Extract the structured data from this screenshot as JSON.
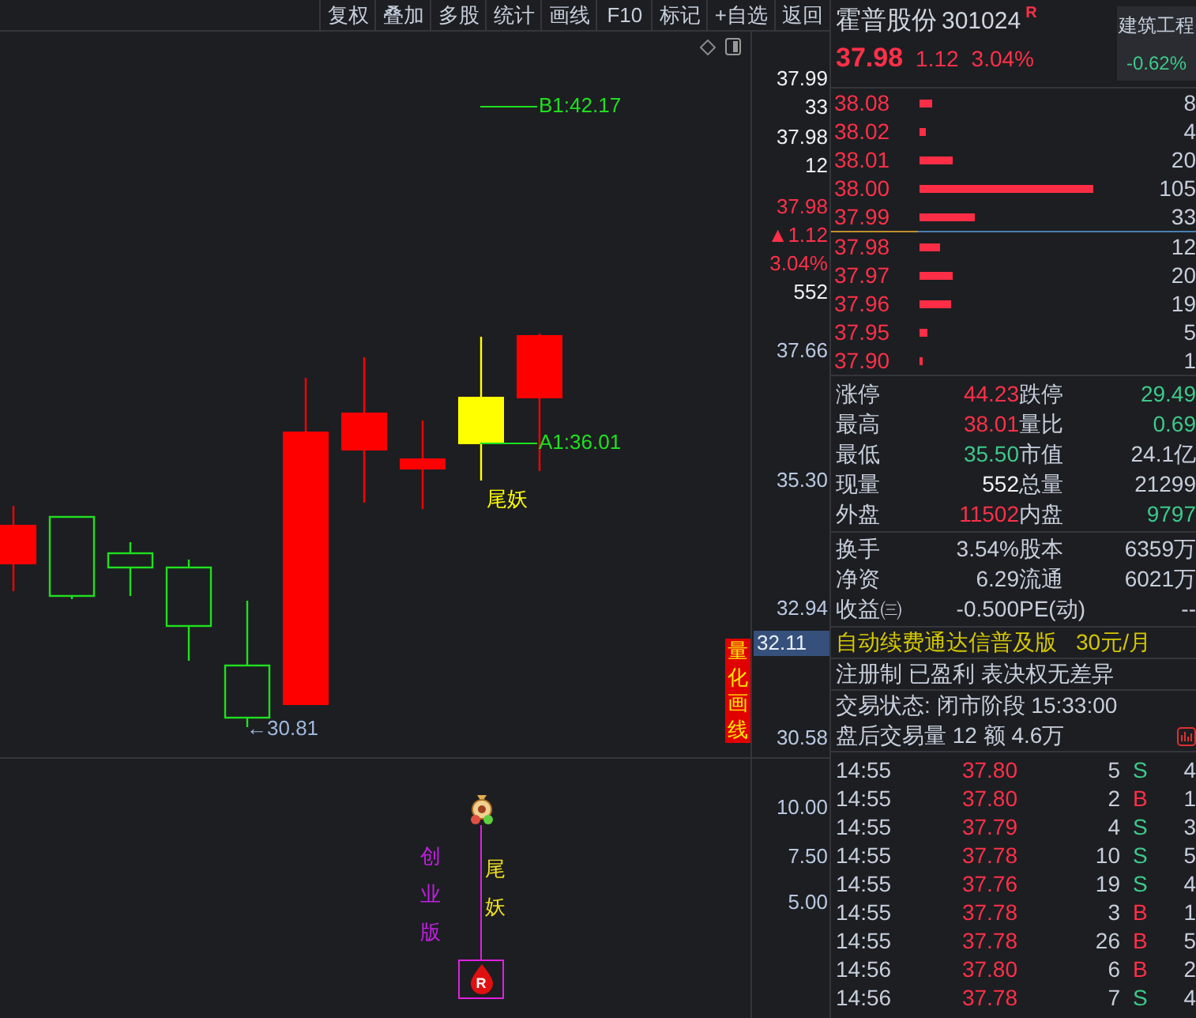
{
  "toolbar": [
    "复权",
    "叠加",
    "多股",
    "统计",
    "画线",
    "F10",
    "标记",
    "+自选",
    "返回"
  ],
  "main_chart": {
    "annotations": [
      {
        "kind": "level",
        "text": "B1:42.17"
      },
      {
        "kind": "level",
        "text": "A1:36.01"
      },
      {
        "kind": "low",
        "text": "←30.81"
      },
      {
        "kind": "tag",
        "text": "尾妖"
      }
    ],
    "side_label": "量化画线",
    "axis": [
      {
        "kind": "quote",
        "text": "37.99"
      },
      {
        "kind": "quote",
        "text": "33"
      },
      {
        "kind": "quote",
        "text": "37.98"
      },
      {
        "kind": "quote",
        "text": "12"
      },
      {
        "kind": "change",
        "text": "37.98"
      },
      {
        "kind": "change",
        "text": "▲1.12"
      },
      {
        "kind": "change",
        "text": "3.04%"
      },
      {
        "kind": "quote",
        "text": "552"
      },
      {
        "kind": "tick",
        "text": "37.66"
      },
      {
        "kind": "tick",
        "text": "35.30"
      },
      {
        "kind": "tick",
        "text": "32.94"
      },
      {
        "kind": "current",
        "text": "32.11"
      },
      {
        "kind": "tick",
        "text": "30.58"
      }
    ]
  },
  "indicator": {
    "labels": [
      {
        "kind": "board",
        "text": "创业版"
      },
      {
        "kind": "tag",
        "text": "尾妖"
      }
    ],
    "badge": "R",
    "axis": [
      "10.00",
      "7.50",
      "5.00"
    ]
  },
  "quote": {
    "name": "霍普股份",
    "code": "301024",
    "badge": "R",
    "price": "37.98",
    "change": "1.12",
    "percent": "3.04%",
    "sector": "建筑工程",
    "sector_change": "-0.62%"
  },
  "order_book": {
    "asks": [
      {
        "price": "38.08",
        "volume": "8"
      },
      {
        "price": "38.02",
        "volume": "4"
      },
      {
        "price": "38.01",
        "volume": "20"
      },
      {
        "price": "38.00",
        "volume": "105"
      },
      {
        "price": "37.99",
        "volume": "33"
      }
    ],
    "bids": [
      {
        "price": "37.98",
        "volume": "12"
      },
      {
        "price": "37.97",
        "volume": "20"
      },
      {
        "price": "37.96",
        "volume": "19"
      },
      {
        "price": "37.95",
        "volume": "5"
      },
      {
        "price": "37.90",
        "volume": "1"
      }
    ]
  },
  "stats": [
    {
      "label": "涨停",
      "value": "44.23",
      "color": "#ff3048"
    },
    {
      "label": "跌停",
      "value": "29.49",
      "color": "#3dc98a"
    },
    {
      "label": "最高",
      "value": "38.01",
      "color": "#ff3048"
    },
    {
      "label": "量比",
      "value": "0.69",
      "color": "#3dc98a"
    },
    {
      "label": "最低",
      "value": "35.50",
      "color": "#3dc98a"
    },
    {
      "label": "市值",
      "value": "24.1亿",
      "color": "#c6cedb"
    },
    {
      "label": "现量",
      "value": "552",
      "color": "#f4f4f4"
    },
    {
      "label": "总量",
      "value": "21299",
      "color": "#c6cedb"
    },
    {
      "label": "外盘",
      "value": "11502",
      "color": "#ff3048"
    },
    {
      "label": "内盘",
      "value": "9797",
      "color": "#3dc98a"
    }
  ],
  "finance": [
    {
      "label": "换手",
      "value": "3.54%"
    },
    {
      "label": "股本",
      "value": "6359万"
    },
    {
      "label": "净资",
      "value": "6.29"
    },
    {
      "label": "流通",
      "value": "6021万"
    },
    {
      "label": "收益㈢",
      "value": "-0.500"
    },
    {
      "label": "PE(动)",
      "value": "--"
    }
  ],
  "promo": {
    "text": "自动续费通达信普及版",
    "price": "30元/月"
  },
  "info": "注册制 已盈利 表决权无差异",
  "status": "交易状态: 闭市阶段 15:33:00",
  "after_hours": "盘后交易量 12 额 4.6万",
  "trades": [
    {
      "time": "14:55",
      "price": "37.80",
      "volume": "5",
      "side": "S",
      "column_5": "4"
    },
    {
      "time": "14:55",
      "price": "37.80",
      "volume": "2",
      "side": "B",
      "column_5": "1"
    },
    {
      "time": "14:55",
      "price": "37.79",
      "volume": "4",
      "side": "S",
      "column_5": "3"
    },
    {
      "time": "14:55",
      "price": "37.78",
      "volume": "10",
      "side": "S",
      "column_5": "5"
    },
    {
      "time": "14:55",
      "price": "37.76",
      "volume": "19",
      "side": "S",
      "column_5": "4"
    },
    {
      "time": "14:55",
      "price": "37.78",
      "volume": "3",
      "side": "B",
      "column_5": "1"
    },
    {
      "time": "14:55",
      "price": "37.78",
      "volume": "26",
      "side": "B",
      "column_5": "5"
    },
    {
      "time": "14:56",
      "price": "37.80",
      "volume": "6",
      "side": "B",
      "column_5": "2"
    },
    {
      "time": "14:56",
      "price": "37.78",
      "volume": "7",
      "side": "S",
      "column_5": "4"
    }
  ]
}
